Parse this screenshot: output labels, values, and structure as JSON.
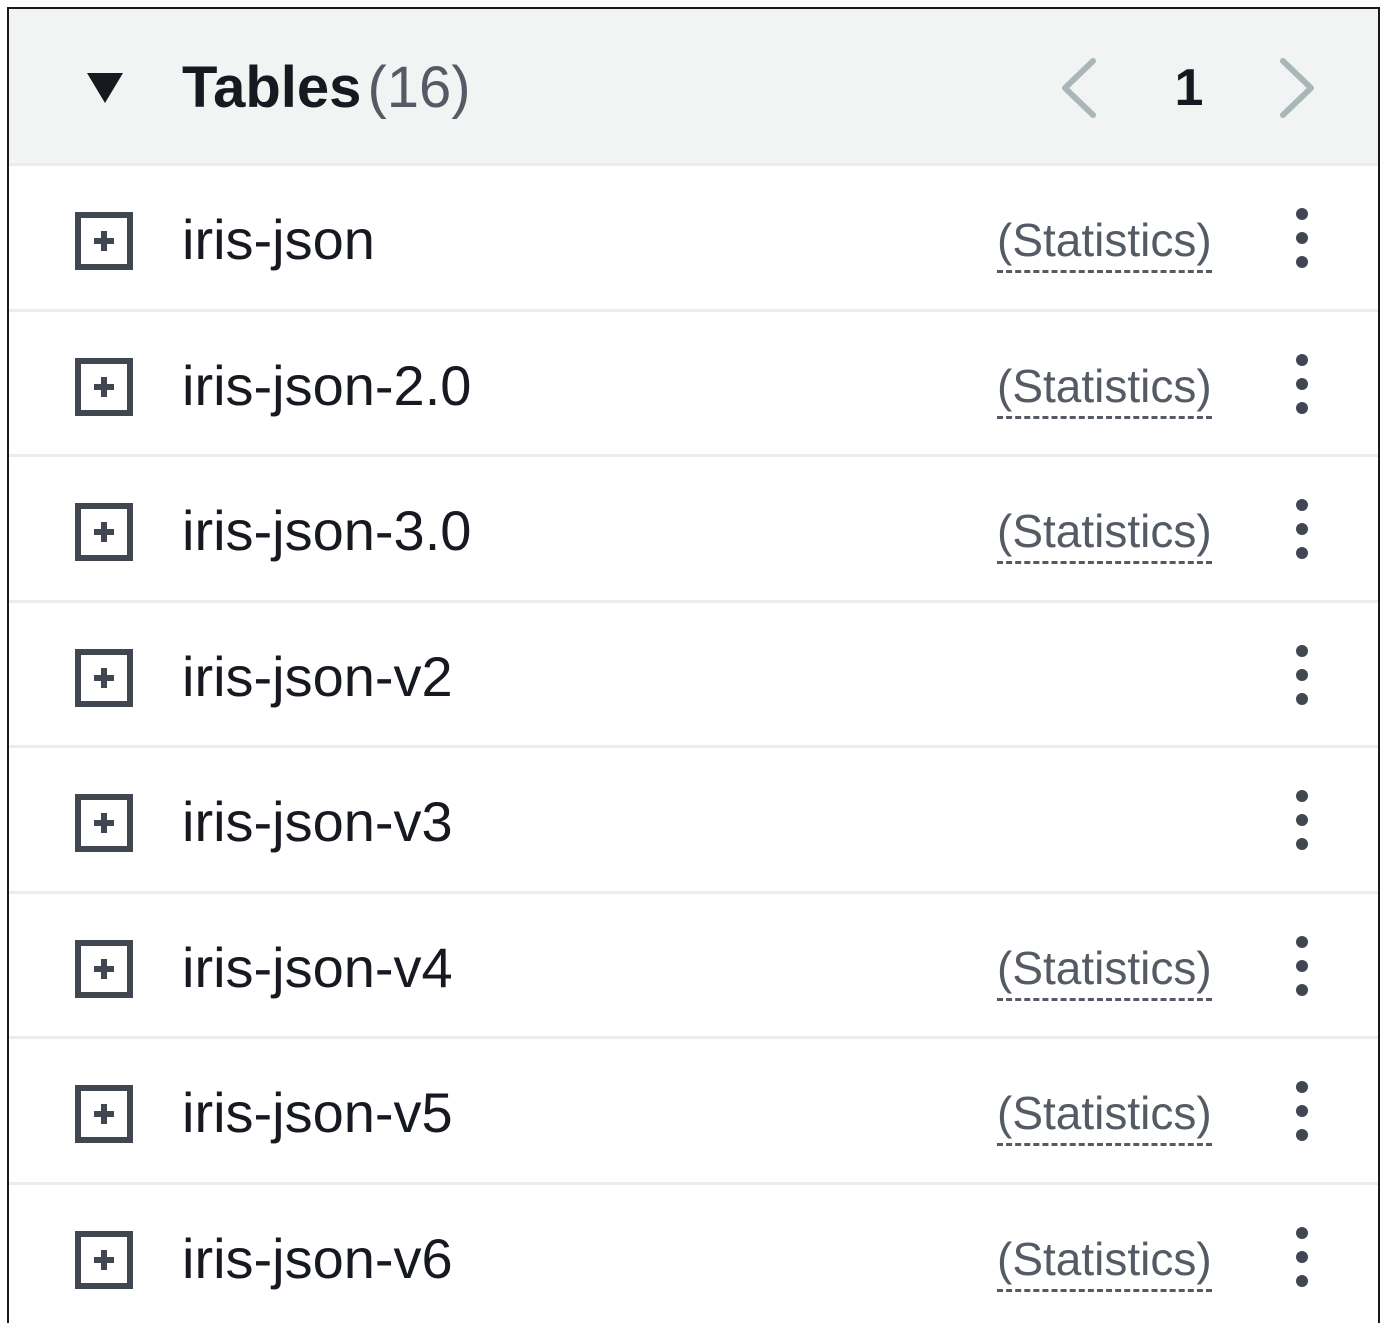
{
  "header": {
    "title": "Tables",
    "count": "(16)",
    "page": "1"
  },
  "rows": [
    {
      "name": "iris-json",
      "stats": "(Statistics)"
    },
    {
      "name": "iris-json-2.0",
      "stats": "(Statistics)"
    },
    {
      "name": "iris-json-3.0",
      "stats": "(Statistics)"
    },
    {
      "name": "iris-json-v2",
      "stats": ""
    },
    {
      "name": "iris-json-v3",
      "stats": ""
    },
    {
      "name": "iris-json-v4",
      "stats": "(Statistics)"
    },
    {
      "name": "iris-json-v5",
      "stats": "(Statistics)"
    },
    {
      "name": "iris-json-v6",
      "stats": "(Statistics)"
    }
  ]
}
